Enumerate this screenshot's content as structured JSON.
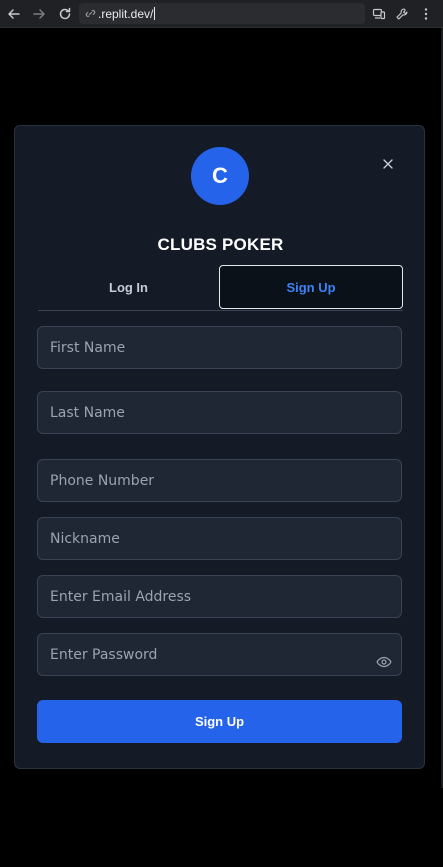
{
  "browser": {
    "url": ".replit.dev/"
  },
  "modal": {
    "avatar_letter": "C",
    "title": "CLUBS POKER",
    "tabs": [
      {
        "label": "Log In",
        "active": false
      },
      {
        "label": "Sign Up",
        "active": true
      }
    ],
    "fields": {
      "first_name": {
        "placeholder": "First Name",
        "value": ""
      },
      "last_name": {
        "placeholder": "Last Name",
        "value": ""
      },
      "phone": {
        "placeholder": "Phone Number",
        "value": ""
      },
      "nickname": {
        "placeholder": "Nickname",
        "value": ""
      },
      "email": {
        "placeholder": "Enter Email Address",
        "value": ""
      },
      "password": {
        "placeholder": "Enter Password",
        "value": ""
      }
    },
    "submit_label": "Sign Up"
  },
  "colors": {
    "accent": "#2563eb",
    "active_tab_text": "#3b82f6",
    "modal_bg": "#141b26",
    "field_bg": "#1f2734"
  },
  "icons": [
    "back-arrow-icon",
    "forward-arrow-icon",
    "reload-icon",
    "link-icon",
    "devices-icon",
    "wrench-icon",
    "more-icon",
    "close-icon",
    "eye-icon"
  ]
}
